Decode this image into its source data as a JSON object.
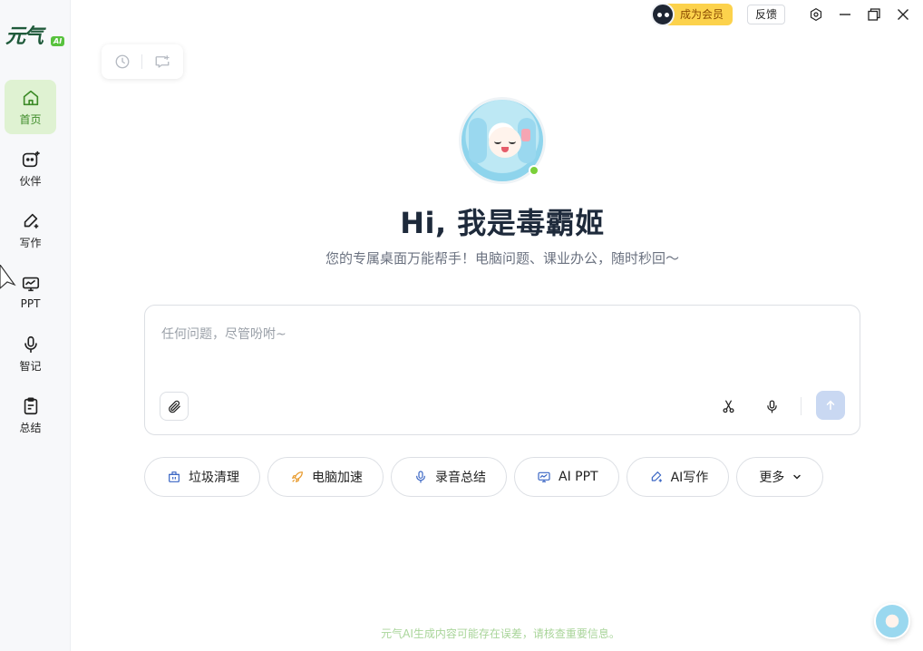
{
  "app": {
    "logo_text": "元气",
    "logo_badge": "AI"
  },
  "sidebar": {
    "items": [
      {
        "label": "首页",
        "icon": "home-icon",
        "active": true
      },
      {
        "label": "伙伴",
        "icon": "companion-icon",
        "active": false
      },
      {
        "label": "写作",
        "icon": "pen-icon",
        "active": false
      },
      {
        "label": "PPT",
        "icon": "ppt-icon",
        "active": false
      },
      {
        "label": "智记",
        "icon": "microphone-icon",
        "active": false
      },
      {
        "label": "总结",
        "icon": "clipboard-icon",
        "active": false
      }
    ]
  },
  "topbar": {
    "vip_label": "成为会员",
    "feedback_label": "反馈"
  },
  "hero": {
    "title": "Hi, 我是毒霸姬",
    "subtitle": "您的专属桌面万能帮手！电脑问题、课业办公，随时秒回～"
  },
  "input": {
    "placeholder": "任何问题，尽管吩咐~",
    "value": ""
  },
  "chips": [
    {
      "label": "垃圾清理",
      "icon": "trash-icon"
    },
    {
      "label": "电脑加速",
      "icon": "rocket-icon"
    },
    {
      "label": "录音总结",
      "icon": "microphone-icon"
    },
    {
      "label": "AI PPT",
      "icon": "ppt-icon"
    },
    {
      "label": "AI写作",
      "icon": "pen-icon"
    },
    {
      "label": "更多",
      "icon": "chevron-down-icon"
    }
  ],
  "footer": {
    "note": "元气AI生成内容可能存在误差，请核查重要信息。"
  },
  "colors": {
    "accent_green": "#3d8b28",
    "active_bg": "#dff2d2",
    "vip_yellow": "#fcd24c",
    "send_disabled": "#c9d8f2",
    "online_dot": "#7bd03a"
  }
}
